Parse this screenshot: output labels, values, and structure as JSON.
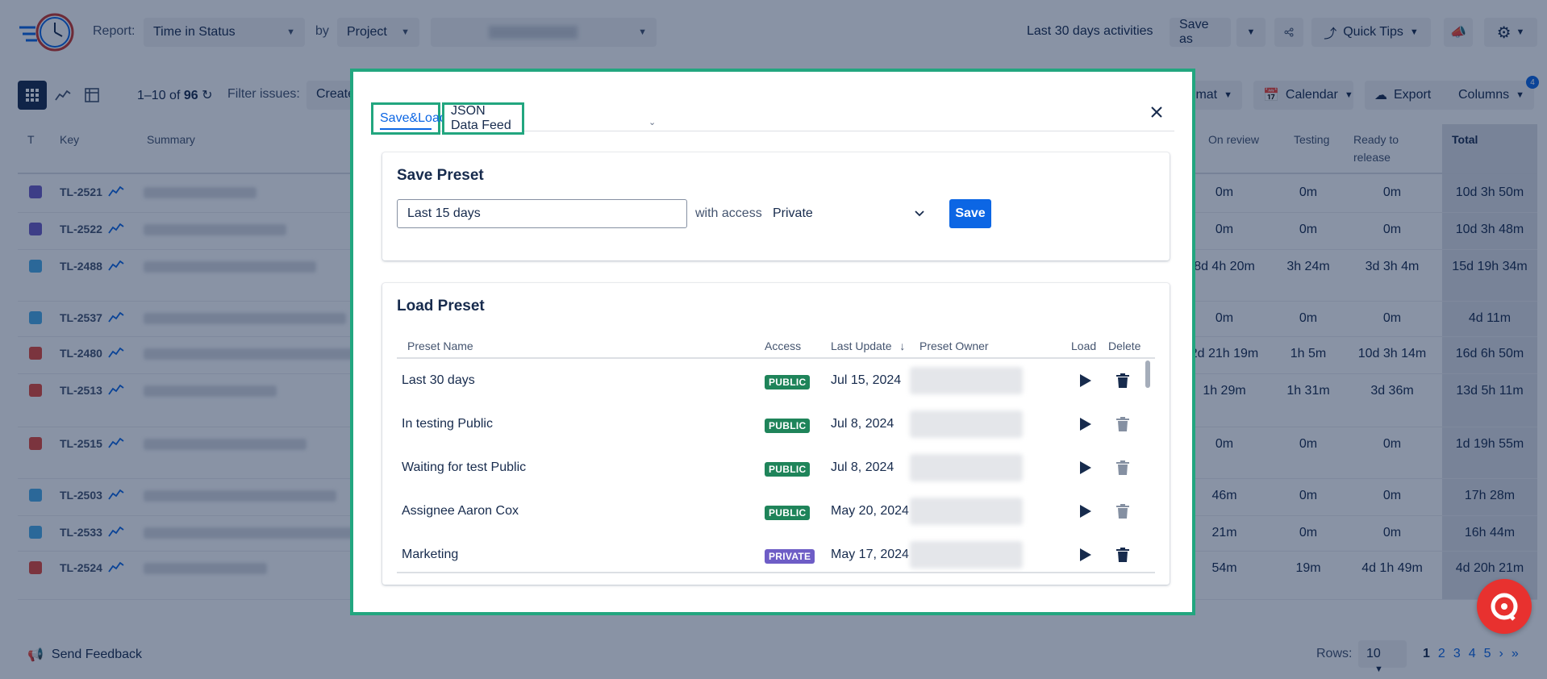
{
  "app": {
    "report_label": "Report:",
    "report_value": "Time in Status",
    "by_label": "by",
    "group_value": "Project",
    "period_text": "Last 30 days activities",
    "save_as_label": "Save as",
    "quick_tips_label": "Quick Tips",
    "pager_range": "1–10",
    "pager_of": "of",
    "pager_total": "96",
    "filter_label": "Filter issues:",
    "filter_value": "Create",
    "format_label": "mat",
    "calendar_label": "Calendar",
    "export_label": "Export",
    "columns_label": "Columns",
    "columns_badge": "4",
    "columns": {
      "t": "T",
      "key": "Key",
      "summary": "Summary",
      "on_review": "On review",
      "testing": "Testing",
      "ready": "Ready to release",
      "total": "Total"
    },
    "rows": [
      {
        "key": "TL-2521",
        "type_color": "#6e5dc6",
        "on_review": "0m",
        "testing": "0m",
        "ready": "0m",
        "total": "10d 3h 50m"
      },
      {
        "key": "TL-2522",
        "type_color": "#6e5dc6",
        "on_review": "0m",
        "testing": "0m",
        "ready": "0m",
        "total": "10d 3h 48m"
      },
      {
        "key": "TL-2488",
        "type_color": "#4bade8",
        "on_review": "8d 4h 20m",
        "testing": "3h 24m",
        "ready": "3d 3h 4m",
        "total": "15d 19h 34m"
      },
      {
        "key": "TL-2537",
        "type_color": "#4bade8",
        "on_review": "0m",
        "testing": "0m",
        "ready": "0m",
        "total": "4d 11m"
      },
      {
        "key": "TL-2480",
        "type_color": "#e5493a",
        "on_review": "2d 21h 19m",
        "testing": "1h 5m",
        "ready": "10d 3h 14m",
        "total": "16d 6h 50m"
      },
      {
        "key": "TL-2513",
        "type_color": "#e5493a",
        "on_review": "1h 29m",
        "testing": "1h 31m",
        "ready": "3d 36m",
        "total": "13d 5h 11m"
      },
      {
        "key": "TL-2515",
        "type_color": "#e5493a",
        "on_review": "0m",
        "testing": "0m",
        "ready": "0m",
        "total": "1d 19h 55m"
      },
      {
        "key": "TL-2503",
        "type_color": "#4bade8",
        "on_review": "46m",
        "testing": "0m",
        "ready": "0m",
        "total": "17h 28m"
      },
      {
        "key": "TL-2533",
        "type_color": "#4bade8",
        "on_review": "21m",
        "testing": "0m",
        "ready": "0m",
        "total": "16h 44m"
      },
      {
        "key": "TL-2524",
        "type_color": "#e5493a",
        "on_review": "54m",
        "testing": "19m",
        "ready": "4d 1h 49m",
        "total": "4d 20h 21m"
      }
    ],
    "send_feedback": "Send Feedback",
    "rows_label": "Rows:",
    "rows_value": "10",
    "pages": [
      "1",
      "2",
      "3",
      "4",
      "5"
    ]
  },
  "modal": {
    "tabs": [
      {
        "label": "Save&Load",
        "active": true
      },
      {
        "label": "JSON Data Feed",
        "active": false
      }
    ],
    "save_preset": {
      "title": "Save Preset",
      "input_value": "Last 15 days",
      "with_access": "with access",
      "access_value": "Private",
      "save_label": "Save"
    },
    "load_preset": {
      "title": "Load Preset",
      "headers": {
        "name": "Preset Name",
        "access": "Access",
        "last_update": "Last Update",
        "owner": "Preset Owner",
        "load": "Load",
        "delete": "Delete"
      },
      "rows": [
        {
          "name": "Last 30 days",
          "access": "PUBLIC",
          "date": "Jul 15, 2024",
          "can_delete": true
        },
        {
          "name": "In testing Public",
          "access": "PUBLIC",
          "date": "Jul 8, 2024",
          "can_delete": false
        },
        {
          "name": "Waiting for test Public",
          "access": "PUBLIC",
          "date": "Jul 8, 2024",
          "can_delete": false
        },
        {
          "name": "Assignee Aaron Cox",
          "access": "PUBLIC",
          "date": "May 20, 2024",
          "can_delete": false
        },
        {
          "name": "Marketing",
          "access": "PRIVATE",
          "date": "May 17, 2024",
          "can_delete": true
        }
      ]
    }
  },
  "colors": {
    "accent": "#0c66e4",
    "highlight": "#22a67f",
    "public_badge": "#1f845a",
    "private_badge": "#6e5dc6",
    "help_fab": "#e8312f"
  }
}
